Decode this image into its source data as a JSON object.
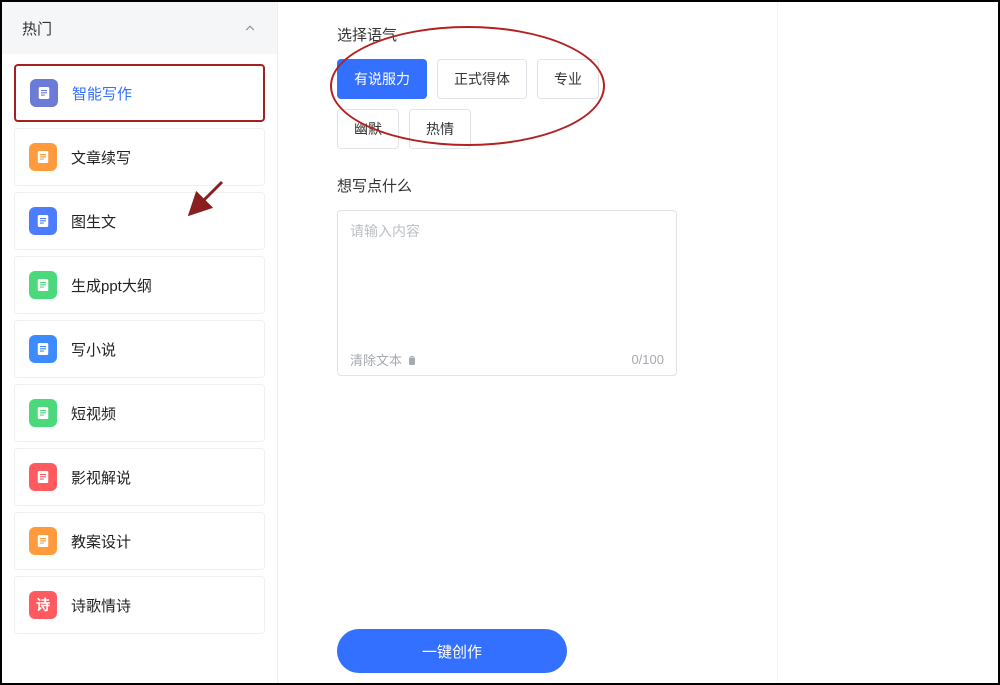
{
  "sidebar": {
    "section_title": "热门",
    "items": [
      {
        "label": "智能写作",
        "selected": true,
        "iconColor": "#6b7bd6"
      },
      {
        "label": "文章续写",
        "selected": false,
        "iconColor": "#ff9a3d"
      },
      {
        "label": "图生文",
        "selected": false,
        "iconColor": "#4d7cff"
      },
      {
        "label": "生成ppt大纲",
        "selected": false,
        "iconColor": "#4cd97b"
      },
      {
        "label": "写小说",
        "selected": false,
        "iconColor": "#3d8bff"
      },
      {
        "label": "短视频",
        "selected": false,
        "iconColor": "#4cd97b"
      },
      {
        "label": "影视解说",
        "selected": false,
        "iconColor": "#ff5a5f"
      },
      {
        "label": "教案设计",
        "selected": false,
        "iconColor": "#ff9a3d"
      },
      {
        "label": "诗歌情诗",
        "selected": false,
        "iconColor": "#ff5a5f",
        "glyph": "诗"
      }
    ]
  },
  "main": {
    "tone_title": "选择语气",
    "tones": [
      {
        "label": "有说服力",
        "selected": true
      },
      {
        "label": "正式得体",
        "selected": false
      },
      {
        "label": "专业",
        "selected": false
      },
      {
        "label": "幽默",
        "selected": false
      },
      {
        "label": "热情",
        "selected": false
      }
    ],
    "prompt_title": "想写点什么",
    "placeholder": "请输入内容",
    "clear_label": "清除文本",
    "counter": "0/100",
    "cta_label": "一键创作"
  }
}
